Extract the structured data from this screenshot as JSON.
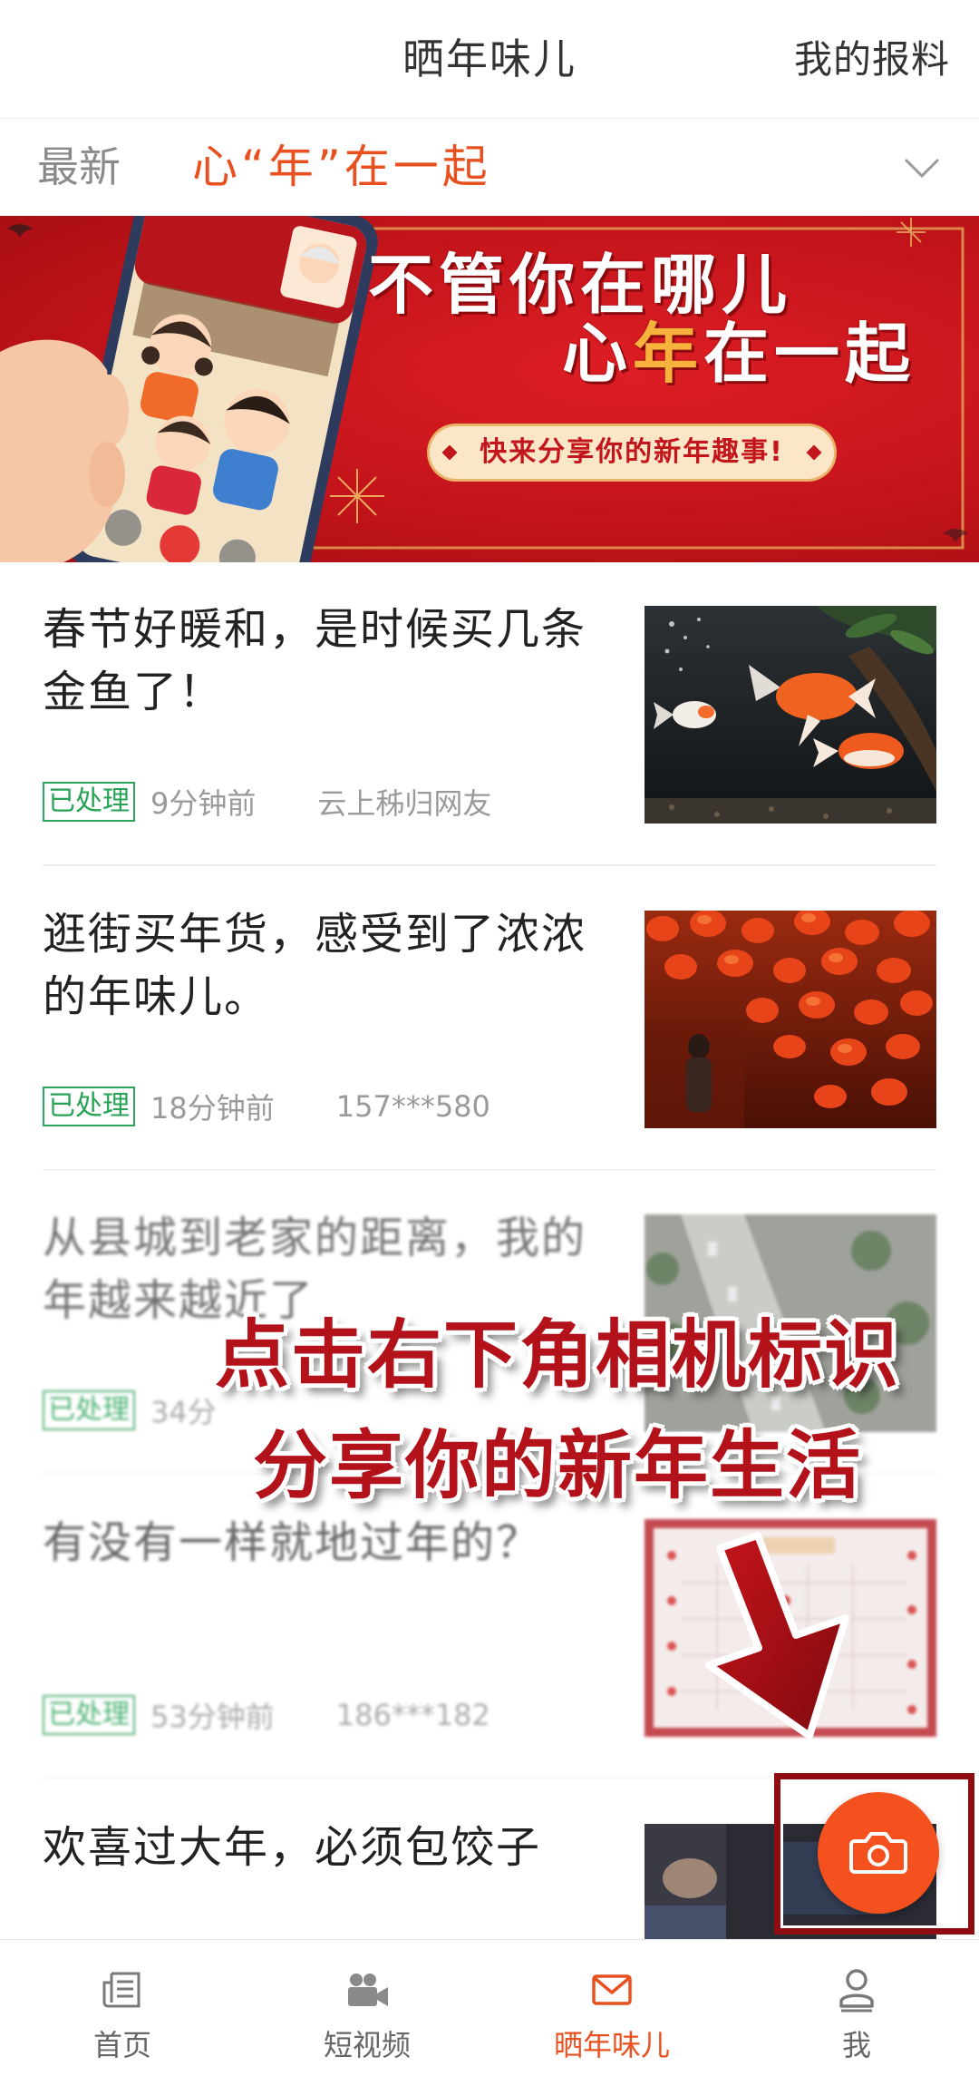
{
  "colors": {
    "accent": "#e8501f",
    "status_green": "#2ea55a",
    "banner_red": "#c8161d",
    "overlay_red": "#b3121b",
    "fab": "#f4511e"
  },
  "header": {
    "title": "晒年味儿",
    "my_reports": "我的报料"
  },
  "tabs": {
    "latest": "最新",
    "active": "心“年”在一起",
    "expand_icon": "chevron-down-icon"
  },
  "banner": {
    "line1": "不管你在哪儿",
    "line2_part1": "心",
    "line2_accent": "年",
    "line2_part2": "在一起",
    "tagline": "快来分享你的新年趣事!"
  },
  "feed": [
    {
      "title": "春节好暖和，是时候买几条金鱼了！",
      "status": "已处理",
      "time": "9分钟前",
      "author": "云上秭归网友"
    },
    {
      "title": "逛街买年货，感受到了浓浓的年味儿。",
      "status": "已处理",
      "time": "18分钟前",
      "author": "157***580"
    },
    {
      "title": "从县城到老家的距离，我的年越来越近了",
      "status": "已处理",
      "time": "34分"
    },
    {
      "title": "有没有一样就地过年的？",
      "status": "已处理",
      "time": "53分钟前",
      "author": "186***182"
    },
    {
      "title": "欢喜过大年，必须包饺子"
    }
  ],
  "overlay": {
    "line1": "点击右下角相机标识",
    "line2": "分享你的新年生活"
  },
  "fab": {
    "icon": "camera-icon"
  },
  "nav": [
    {
      "label": "首页",
      "icon": "newspaper-icon",
      "active": false
    },
    {
      "label": "短视频",
      "icon": "video-camera-icon",
      "active": false
    },
    {
      "label": "晒年味儿",
      "icon": "envelope-icon",
      "active": true
    },
    {
      "label": "我",
      "icon": "person-icon",
      "active": false
    }
  ]
}
